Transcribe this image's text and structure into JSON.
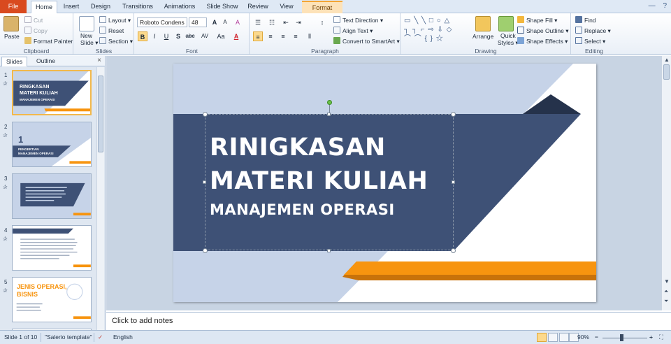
{
  "tabs": [
    "File",
    "Home",
    "Insert",
    "Design",
    "Transitions",
    "Animations",
    "Slide Show",
    "Review",
    "View",
    "Format"
  ],
  "window_ctrls": {
    "minimize": "—",
    "help": "?"
  },
  "ribbon": {
    "clipboard": {
      "label": "Clipboard",
      "paste": "Paste",
      "cut": "Cut",
      "copy": "Copy",
      "format_painter": "Format Painter"
    },
    "slides": {
      "label": "Slides",
      "new_slide": "New",
      "new_slide2": "Slide",
      "layout": "Layout",
      "reset": "Reset",
      "section": "Section"
    },
    "font": {
      "label": "Font",
      "font_name": "Roboto Condens",
      "font_size": "48",
      "grow": "A",
      "shrink": "A",
      "clear": "A",
      "bold": "B",
      "italic": "I",
      "underline": "U",
      "strike": "S",
      "abc": "abc",
      "spacing": "AV",
      "case": "Aa",
      "color": "A"
    },
    "paragraph": {
      "label": "Paragraph",
      "text_direction": "Text Direction",
      "align_text": "Align Text",
      "smartart": "Convert to SmartArt"
    },
    "drawing": {
      "label": "Drawing",
      "arrange": "Arrange",
      "quick": "Quick",
      "styles": "Styles",
      "shape_fill": "Shape Fill",
      "shape_outline": "Shape Outline",
      "shape_effects": "Shape Effects"
    },
    "editing": {
      "label": "Editing",
      "find": "Find",
      "replace": "Replace",
      "select": "Select"
    }
  },
  "left_pane": {
    "tabs": [
      "Slides",
      "Outline"
    ],
    "close": "×",
    "thumbs": [
      {
        "num": "1",
        "title1": "RINGKASAN",
        "title2": "MATERI KULIAH",
        "sub": "MANAJEMEN OPERASI"
      },
      {
        "num": "2",
        "big": "1",
        "title1": "PENGERTIAN",
        "title2": "MANAJEMEN OPERASI"
      },
      {
        "num": "3"
      },
      {
        "num": "4"
      },
      {
        "num": "5",
        "title1": "JENIS OPERASI,",
        "title2": "BISNIS"
      }
    ]
  },
  "slide": {
    "title_line1": "RINIGKASAN",
    "title_line2": "MATERI KULIAH",
    "subtitle": "MANAJEMEN OPERASI",
    "colors": {
      "light_blue": "#c6d3e8",
      "navy": "#3e5176",
      "dark_navy": "#25324b",
      "orange": "#f7940f",
      "orange_dark": "#c8720a"
    }
  },
  "notes": {
    "placeholder": "Click to add notes"
  },
  "status": {
    "slide_info": "Slide 1 of 10",
    "theme": "\"Salerio template\"",
    "language": "English",
    "zoom": "90%"
  }
}
